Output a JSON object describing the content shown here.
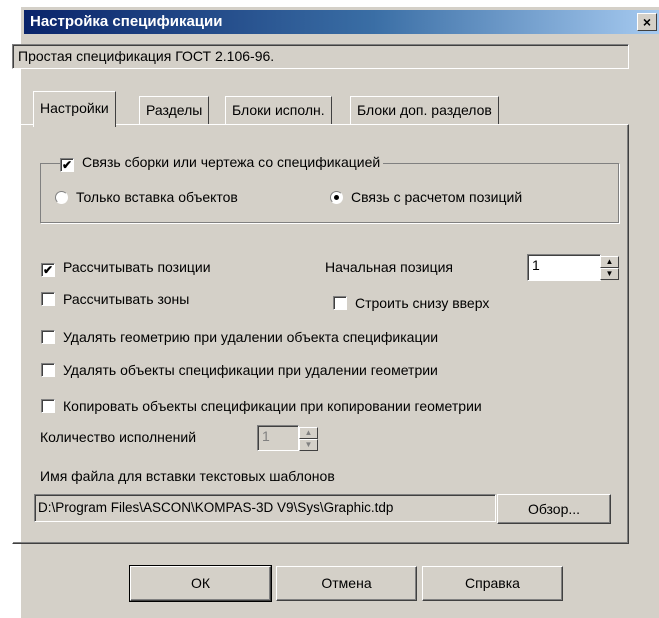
{
  "window": {
    "title": "Настройка спецификации",
    "close_label": "×"
  },
  "description": "Простая спецификация ГОСТ 2.106-96.",
  "tabs": [
    {
      "label": "Настройки",
      "active": true
    },
    {
      "label": "Разделы",
      "active": false
    },
    {
      "label": "Блоки исполн.",
      "active": false
    },
    {
      "label": "Блоки доп. разделов",
      "active": false
    }
  ],
  "link_group": {
    "checkbox_label": "Связь сборки или чертежа со спецификацией",
    "checked": true,
    "radio_insert_only": "Только вставка объектов",
    "radio_with_positions": "Связь с расчетом позиций",
    "selected": "radio_with_positions"
  },
  "options": {
    "calc_positions": {
      "label": "Рассчитывать позиции",
      "checked": true
    },
    "start_position_label": "Начальная позиция",
    "start_position_value": "1",
    "calc_zones": {
      "label": "Рассчитывать зоны",
      "checked": false
    },
    "build_bottom_up": {
      "label": "Строить снизу вверх",
      "checked": false
    },
    "delete_geometry": {
      "label": "Удалять геометрию при удалении объекта спецификации",
      "checked": false
    },
    "delete_objects": {
      "label": "Удалять объекты спецификации при удалении геометрии",
      "checked": false
    },
    "copy_objects": {
      "label": "Копировать объекты спецификации при копировании геометрии",
      "checked": false
    },
    "versions_count_label": "Количество исполнений",
    "versions_count_value": "1"
  },
  "template_file": {
    "label": "Имя файла для вставки текстовых шаблонов",
    "path": "D:\\Program Files\\ASCON\\KOMPAS-3D V9\\Sys\\Graphic.tdp",
    "browse_label": "Обзор..."
  },
  "buttons": {
    "ok": "ОК",
    "cancel": "Отмена",
    "help": "Справка"
  },
  "colors": {
    "face": "#d4d0c8",
    "title_start": "#0a246a",
    "title_end": "#a6caf0"
  }
}
